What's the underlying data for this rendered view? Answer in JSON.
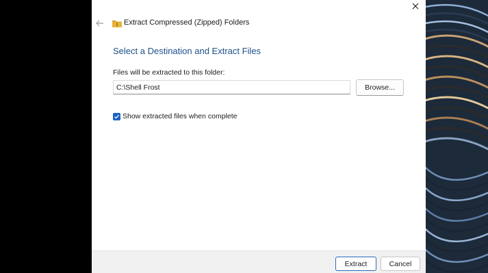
{
  "window": {
    "title": "Extract Compressed (Zipped) Folders",
    "close_icon": "close-icon",
    "back_icon": "arrow-left-icon",
    "folder_icon": "zipped-folder-icon"
  },
  "main": {
    "heading": "Select a Destination and Extract Files",
    "destination_label": "Files will be extracted to this folder:",
    "destination_value": "C:\\Shell Frost",
    "browse_label": "Browse...",
    "show_files_checkbox": {
      "label": "Show extracted files when complete",
      "checked": true
    }
  },
  "footer": {
    "extract_label": "Extract",
    "cancel_label": "Cancel"
  },
  "colors": {
    "heading": "#1b4f8a",
    "accent": "#1b64c2",
    "footer_bg": "#f1f1f1",
    "folder_yellow": "#e8b43a"
  }
}
